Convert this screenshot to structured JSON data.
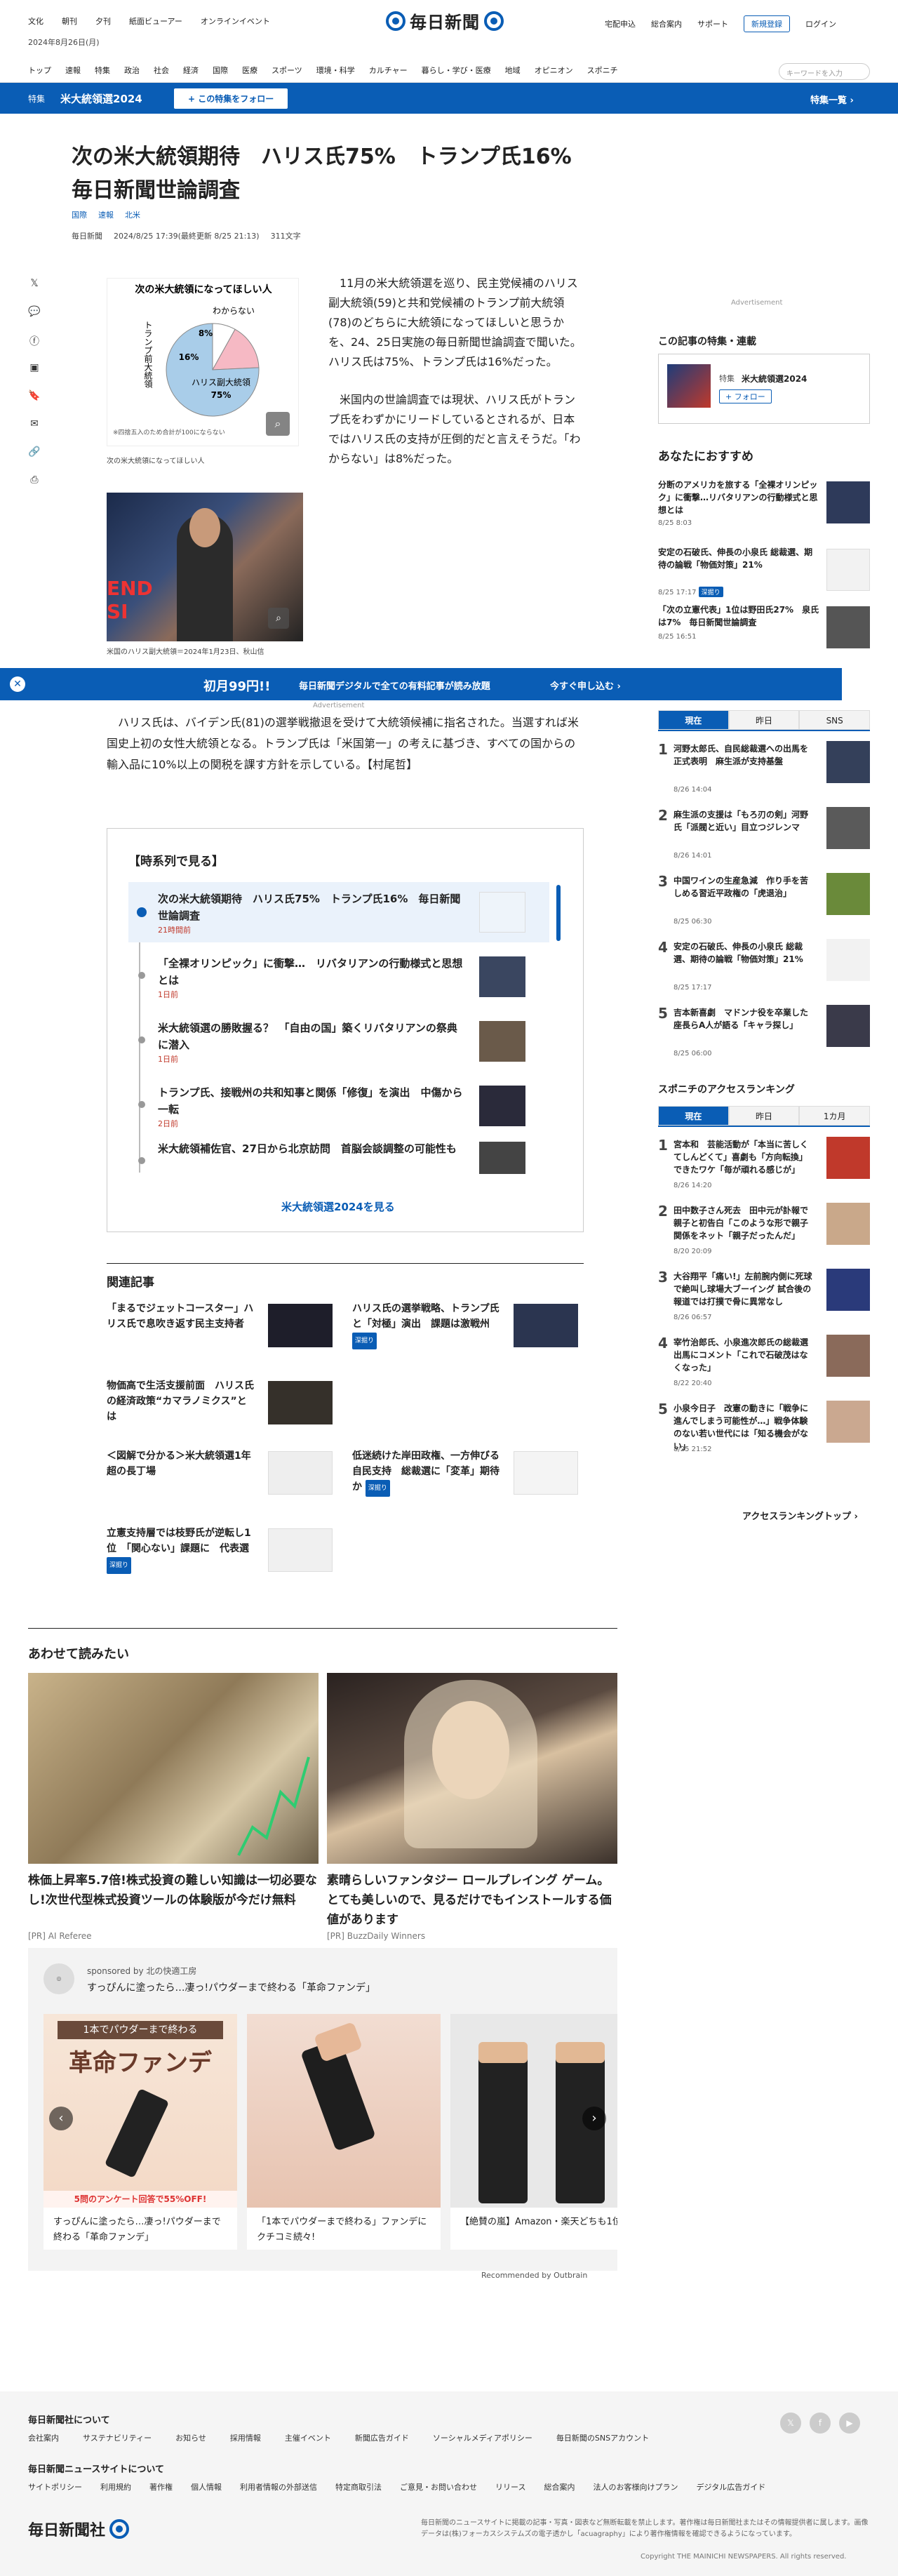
{
  "header": {
    "top_links": [
      "文化",
      "朝刊",
      "夕刊",
      "紙面ビューアー",
      "オンラインイベント"
    ],
    "date": "2024年8月26日(月)",
    "logo": "毎日新聞",
    "right_links": [
      "宅配申込",
      "総合案内",
      "サポート"
    ],
    "register": "新規登録",
    "login": "ログイン",
    "nav": [
      "トップ",
      "速報",
      "特集",
      "政治",
      "社会",
      "経済",
      "国際",
      "医療",
      "スポーツ",
      "環境・科学",
      "カルチャー",
      "暮らし・学び・医療",
      "地域",
      "オピニオン",
      "スポニチ"
    ],
    "search_placeholder": "キーワードを入力"
  },
  "special": {
    "label": "特集",
    "title": "米大統領選2024",
    "follow": "+ この特集をフォロー",
    "list": "特集一覧 ›"
  },
  "article": {
    "headline": "次の米大統領期待　ハリス氏75%　トランプ氏16%　毎日新聞世論調査",
    "tags": [
      "国際",
      "速報",
      "北米"
    ],
    "source": "毎日新聞",
    "timestamp": "2024/8/25 17:39(最終更新 8/25 21:13)",
    "chars": "311文字",
    "fig1_title": "次の米大統領になってほしい人",
    "fig1_caption": "次の米大統領になってほしい人",
    "fig1_note": "※四捨五入のため合計が100にならない",
    "fig2_caption": "米国のハリス副大統領＝2024年1月23日、秋山信",
    "para1": "11月の米大統領選を巡り、民主党候補のハリス副大統領(59)と共和党候補のトランプ前大統領(78)のどちらに大統領になってほしいと思うかを、24、25日実施の毎日新聞世論調査で聞いた。ハリス氏は75%、トランプ氏は16%だった。",
    "para2": "米国内の世論調査では現状、ハリス氏がトランプ氏をわずかにリードしているとされるが、日本ではハリス氏の支持が圧倒的だと言えそうだ。「わからない」は8%だった。",
    "para3": "ハリス氏は、バイデン氏(81)の選挙戦撤退を受けて大統領候補に指名された。当選すれば米国史上初の女性大統領となる。トランプ氏は「米国第一」の考えに基づき、すべての国からの輸入品に10%以上の関税を課す方針を示している。【村尾哲】"
  },
  "chart_data": {
    "type": "pie",
    "title": "次の米大統領になってほしい人",
    "slices": [
      {
        "label": "ハリス副大統領",
        "value": 75,
        "color": "#a9cde9"
      },
      {
        "label": "トランプ前大統領",
        "value": 16,
        "color": "#f6b9c4"
      },
      {
        "label": "わからない",
        "value": 8,
        "color": "#ffffff"
      }
    ]
  },
  "promo": {
    "price": "初月99円!!",
    "text": "毎日新聞デジタルで全ての有料記事が読み放題",
    "cta": "今すぐ申し込む ›"
  },
  "ad_label": "Advertisement",
  "timeline": {
    "title": "【時系列で見る】",
    "items": [
      {
        "text": "次の米大統領期待　ハリス氏75%　トランプ氏16%　毎日新聞世論調査",
        "time": "21時間前"
      },
      {
        "text": "「全裸オリンピック」に衝撃…　リバタリアンの行動様式と思想とは",
        "time": "1日前"
      },
      {
        "text": "米大統領選の勝敗握る？　「自由の国」築くリバタリアンの祭典に潜入",
        "time": "1日前"
      },
      {
        "text": "トランプ氏、接戦州の共和知事と関係「修復」を演出　中傷から一転",
        "time": "2日前"
      },
      {
        "text": "米大統領補佐官、27日から北京訪問　首脳会談調整の可能性も",
        "time": "2日前"
      }
    ],
    "more": "米大統領選2024を見る"
  },
  "related": {
    "title": "関連記事",
    "items": [
      {
        "text": "「まるでジェットコースター」ハリス氏で息吹き返す民主支持者",
        "badge": ""
      },
      {
        "text": "ハリス氏の選挙戦略、トランプ氏と「対極」演出　課題は激戦州",
        "badge": "深掘り"
      },
      {
        "text": "物価高で生活支援前面　ハリス氏の経済政策“カマラノミクス”とは",
        "badge": ""
      },
      {
        "text": "＜図解で分かる＞米大統領選1年超の長丁場",
        "badge": ""
      },
      {
        "text": "低迷続けた岸田政権、一方伸びる自民支持　総裁選に「変革」期待か",
        "badge": "深掘り"
      },
      {
        "text": "立憲支持層では枝野氏が逆転し1位　「関心ない」課題に　代表選",
        "badge": "深掘り"
      }
    ]
  },
  "awase": {
    "title": "あわせて読みたい",
    "items": [
      {
        "text": "株価上昇率5.7倍!株式投資の難しい知識は一切必要なし!次世代型株式投資ツールの体験版が今だけ無料",
        "src": "[PR] AI Referee"
      },
      {
        "text": "素晴らしいファンタジー ロールプレイング ゲーム。とても美しいので、見るだけでもインストールする価値があります",
        "src": "[PR] BuzzDaily Winners"
      }
    ]
  },
  "sponsor": {
    "line1": "sponsored by 北の快適工房",
    "line2": "すっぴんに塗ったら…凄っ!パウダーまで終わる「革命ファンデ」",
    "cards": [
      {
        "text": "すっぴんに塗ったら…凄っ!パウダーまで終わる「革命ファンデ」",
        "banner": "1本でパウダーまで終わる",
        "big": "革命ファンデ",
        "sale": "5問のアンケート回答で55%OFF!"
      },
      {
        "text": "「1本でパウダーまで終わる」ファンデにクチコミ続々!"
      },
      {
        "text": "【絶賛の嵐】Amazon・楽天どちも1位!?"
      }
    ],
    "outbrain": "Recommended by Outbrain"
  },
  "sidebar": {
    "feature_title": "この記事の特集・連載",
    "feature_label": "特集",
    "feature_name": "米大統領選2024",
    "feature_follow": "+ フォロー",
    "rec_title": "あなたにおすすめ",
    "recs": [
      {
        "text": "分断のアメリカを旅する「全裸オリンピック」に衝撃…リバタリアンの行動様式と思想とは",
        "date": "8/25 8:03"
      },
      {
        "text": "安定の石破氏、伸長の小泉氏 総裁選、期待の論戦「物価対策」21%",
        "date": "8/25 17:17",
        "badge": "深掘り"
      },
      {
        "text": "「次の立憲代表」1位は野田氏27%　泉氏は7%　毎日新聞世論調査",
        "date": "8/25 16:51"
      }
    ],
    "tabs1": [
      "現在",
      "昨日",
      "SNS"
    ],
    "ranks1": [
      {
        "text": "河野太郎氏、自民総裁選への出馬を正式表明　麻生派が支持基盤",
        "date": "8/26 14:04"
      },
      {
        "text": "麻生派の支援は「もろ刃の剣」河野氏「派閥と近い」目立つジレンマ",
        "date": "8/26 14:01"
      },
      {
        "text": "中国ワインの生産急減　作り手を苦しめる習近平政権の「虎退治」",
        "date": "8/25 06:30"
      },
      {
        "text": "安定の石破氏、伸長の小泉氏 総裁選、期待の論戦「物価対策」21%",
        "date": "8/25 17:17"
      },
      {
        "text": "吉本新喜劇　マドンナ役を卒業した座長らA人が語る「キャラ探し」",
        "date": "8/25 06:00"
      }
    ],
    "spon_title": "スポニチのアクセスランキング",
    "tabs2": [
      "現在",
      "昨日",
      "1カ月"
    ],
    "ranks2": [
      {
        "text": "宮本和　芸能活動が「本当に苦しくてしんどくて」喜劇も「方向転換」できたワケ「毎が頑れる感じが」",
        "date": "8/26 14:20"
      },
      {
        "text": "田中数子さん死去　田中元が訃報で親子と初告白「このような形で親子関係をネット「親子だったんだ」",
        "date": "8/20 20:09"
      },
      {
        "text": "大谷翔平「痛い!」左前腕内側に死球で絶叫し球場大ブーイング 試合後の報道では打撲で骨に異常なし",
        "date": "8/26 06:57"
      },
      {
        "text": "宰竹治郎氏、小泉進次郎氏の総裁選出馬にコメント「これで石破茂はなくなった」",
        "date": "8/22 20:40"
      },
      {
        "text": "小泉今日子　改憲の動きに「戦争に進んでしまう可能性が…」戦争体験のない若い世代には「知る機会がない」",
        "date": "8/25 21:52"
      }
    ],
    "rank_more": "アクセスランキングトップ ›"
  },
  "footer": {
    "h1": "毎日新聞社について",
    "links1": [
      "会社案内",
      "サステナビリティー",
      "お知らせ",
      "採用情報",
      "主催イベント",
      "新聞広告ガイド",
      "ソーシャルメディアポリシー",
      "毎日新聞のSNSアカウント"
    ],
    "h2": "毎日新聞ニュースサイトについて",
    "links2": [
      "サイトポリシー",
      "利用規約",
      "著作権",
      "個人情報",
      "利用者情報の外部送信",
      "特定商取引法",
      "ご意見・お問い合わせ",
      "リリース",
      "総合案内",
      "法人のお客様向けプラン",
      "デジタル広告ガイド"
    ],
    "logo": "毎日新聞社",
    "note": "毎日新聞のニュースサイトに掲載の記事・写真・図表など無断転載を禁止します。著作権は毎日新聞社またはその情報提供者に属します。画像データは(株)フォーカスシステムズの電子透かし「acuagraphy」により著作権情報を確認できるようになっています。",
    "copyright": "Copyright THE MAINICHI NEWSPAPERS. All rights reserved."
  }
}
